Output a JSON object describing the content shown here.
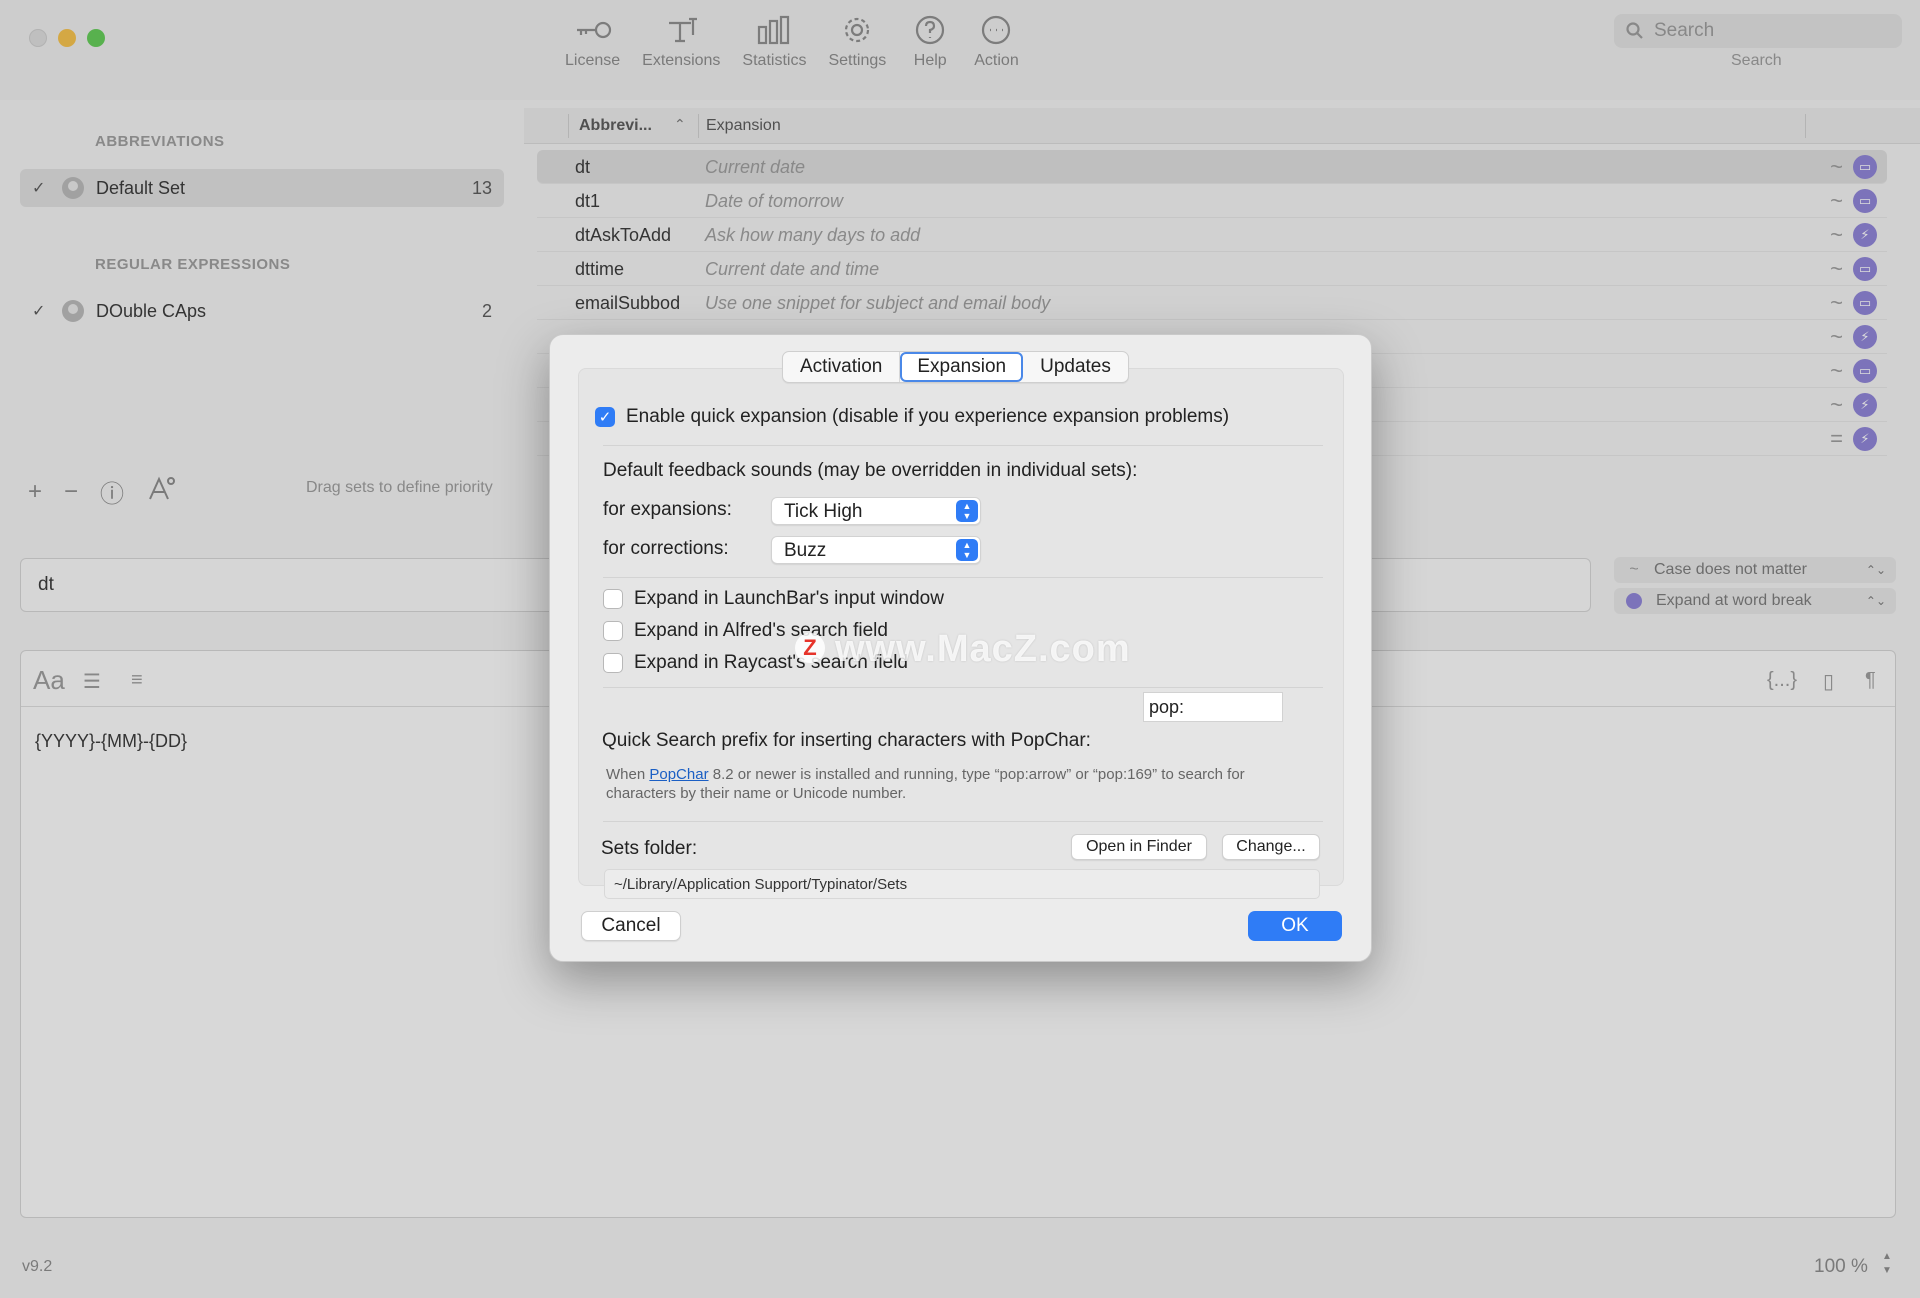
{
  "toolbar": {
    "items": [
      {
        "label": "License",
        "icon": "key-icon"
      },
      {
        "label": "Extensions",
        "icon": "extensions-icon"
      },
      {
        "label": "Statistics",
        "icon": "bar-chart-icon"
      },
      {
        "label": "Settings",
        "icon": "gear-icon"
      },
      {
        "label": "Help",
        "icon": "question-icon"
      },
      {
        "label": "Action",
        "icon": "ellipsis-icon"
      }
    ],
    "search_placeholder": "Search",
    "search_caption": "Search"
  },
  "sidebar": {
    "abbreviations_title": "ABBREVIATIONS",
    "regex_title": "REGULAR EXPRESSIONS",
    "sets": [
      {
        "checked": "✓",
        "name": "Default Set",
        "count": "13"
      },
      {
        "checked": "✓",
        "name": "DOuble CAps",
        "count": "2"
      }
    ],
    "tools": {
      "add": "+",
      "remove": "−",
      "info": "ⓘ"
    },
    "drag_hint": "Drag sets to define priority"
  },
  "table": {
    "col_abbr": "Abbrevi...",
    "col_exp": "Expansion",
    "sort_indicator": "⌃",
    "rows": [
      {
        "abbr": "dt",
        "exp": "Current date",
        "mode": "~"
      },
      {
        "abbr": "dt1",
        "exp": "Date of tomorrow",
        "mode": "~"
      },
      {
        "abbr": "dtAskToAdd",
        "exp": "Ask how many days to add",
        "mode": "~"
      },
      {
        "abbr": "dttime",
        "exp": "Current date and time",
        "mode": "~"
      },
      {
        "abbr": "emailSubbod",
        "exp": "Use one snippet for subject and email body",
        "mode": "~"
      },
      {
        "abbr": "",
        "exp": "",
        "mode": "~"
      },
      {
        "abbr": "",
        "exp": "",
        "mode": "~"
      },
      {
        "abbr": "",
        "exp": "",
        "mode": "~"
      },
      {
        "abbr": "",
        "exp": "",
        "mode": "="
      }
    ]
  },
  "editor": {
    "abbreviation_value": "dt",
    "case_option": "Case does not matter",
    "expand_option": "Expand at word break",
    "toolbar_aa": "Aa",
    "toolbar_braces": "{...}",
    "toolbar_pilcrow": "¶",
    "content": "{YYYY}-{MM}-{DD}",
    "version": "v9.2",
    "zoom": "100 %"
  },
  "dialog": {
    "tabs": [
      "Activation",
      "Expansion",
      "Updates"
    ],
    "active_tab": "Expansion",
    "quick_expansion_label": "Enable quick expansion (disable if you experience expansion problems)",
    "feedback_heading": "Default feedback sounds (may be overridden in individual sets):",
    "for_expansions_label": "for expansions:",
    "for_expansions_value": "Tick High",
    "for_corrections_label": "for corrections:",
    "for_corrections_value": "Buzz",
    "launchbar_label": "Expand in LaunchBar's input window",
    "alfred_label": "Expand in Alfred's search field",
    "raycast_label": "Expand in Raycast's search field",
    "popchar_prefix_label": "Quick Search prefix for inserting characters with PopChar:",
    "popchar_prefix_value": "pop:",
    "help_pre": "When ",
    "help_link": "PopChar",
    "help_post": " 8.2 or newer is installed and running, type “pop:arrow” or “pop:169” to search for characters by their name or Unicode number.",
    "sets_folder_label": "Sets folder:",
    "open_in_finder": "Open in Finder",
    "change": "Change...",
    "sets_folder_path": "~/Library/Application Support/Typinator/Sets",
    "cancel": "Cancel",
    "ok": "OK"
  },
  "watermark": {
    "logo": "Z",
    "text": "www.MacZ.com"
  },
  "colors": {
    "accent": "#2f7cf6",
    "badge": "#8a7fd6"
  }
}
